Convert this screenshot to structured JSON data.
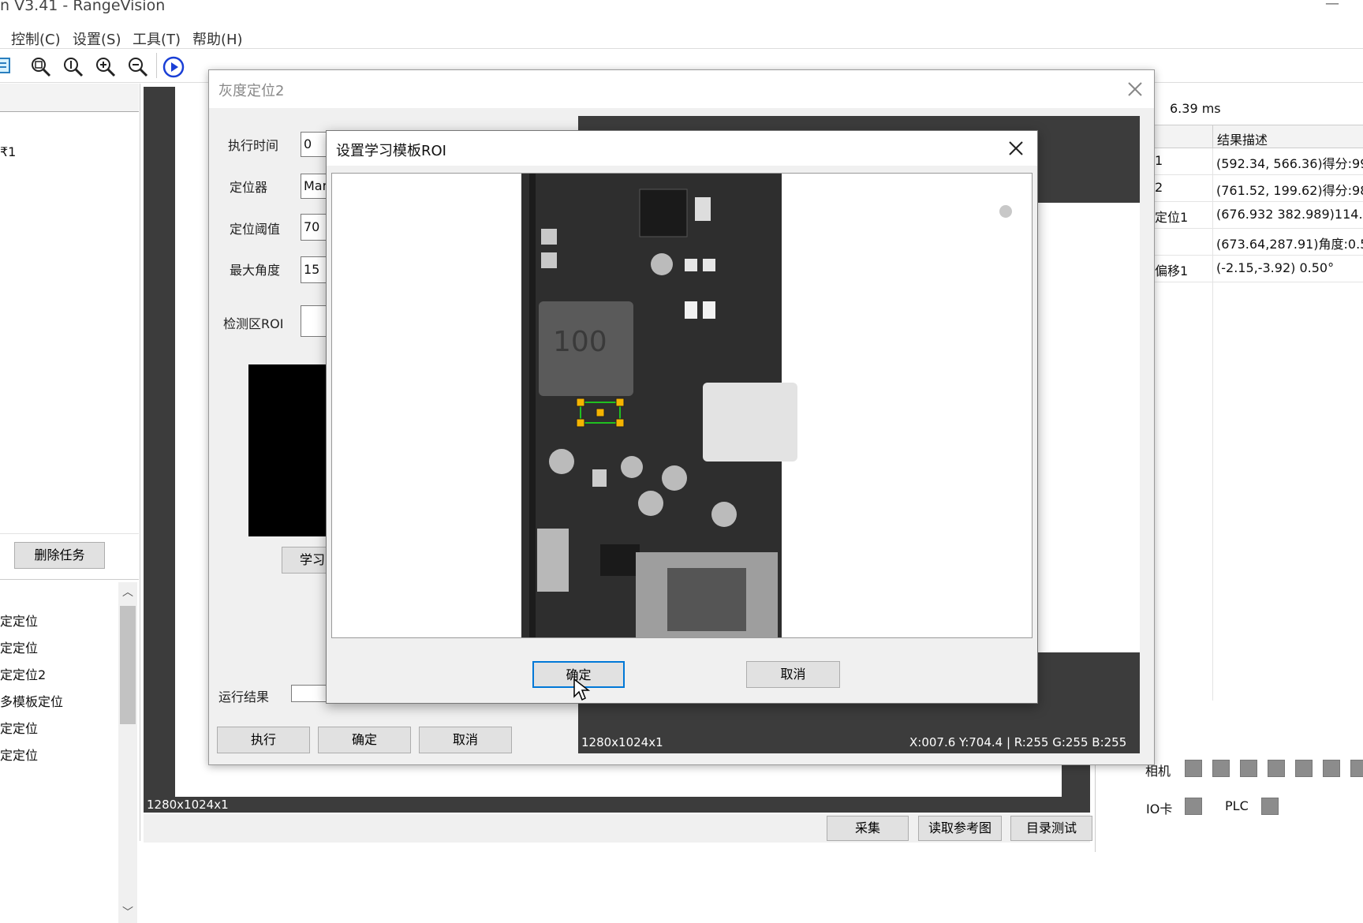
{
  "app": {
    "title": "n V3.41 - RangeVision",
    "minimize": "—"
  },
  "menu": [
    "控制(C)",
    "设置(S)",
    "工具(T)",
    "帮助(H)"
  ],
  "toolbar": {
    "icons": [
      "list-icon",
      "zoom-fit-icon",
      "zoom-actual-icon",
      "zoom-in-icon",
      "zoom-out-icon",
      "run-icon"
    ]
  },
  "left_panel": {
    "top_item": "₹1",
    "delete_task_label": "删除任务",
    "tool_list": [
      "定定位",
      "定定位",
      "定定位2",
      "多模板定位",
      "定定位",
      "定定位"
    ]
  },
  "main_canvas": {
    "image_info": "1280x1024x1"
  },
  "bottom_buttons": {
    "capture": "采集",
    "read_ref": "读取参考图",
    "dir_test": "目录测试"
  },
  "right_panel": {
    "exec_time": "6.39 ms",
    "col_header": "结果描述",
    "results": [
      {
        "name": "1",
        "desc": "(592.34, 566.36)得分:99"
      },
      {
        "name": "2",
        "desc": "(761.52, 199.62)得分:98"
      },
      {
        "name": "定位1",
        "desc": "(676.932 382.989)114.7"
      },
      {
        "name": "",
        "desc": "(673.64,287.91)角度:0.5"
      },
      {
        "name": "偏移1",
        "desc": "(-2.15,-3.92) 0.50°"
      }
    ],
    "camera_label": "相机",
    "io_label": "IO卡",
    "plc_label": "PLC"
  },
  "gray_dialog": {
    "title": "灰度定位2",
    "exec_time_label": "执行时间",
    "exec_time_value": "0",
    "locator_label": "定位器",
    "locator_value": "Mar",
    "threshold_label": "定位阈值",
    "threshold_value": "70",
    "max_angle_label": "最大角度",
    "max_angle_value": "15",
    "roi_label": "检测区ROI",
    "learn_label": "学习",
    "result_label": "运行结果",
    "exec_button": "执行",
    "ok_button": "确定",
    "cancel_button": "取消",
    "image_info": "1280x1024x1",
    "pixel_info": "X:007.6 Y:704.4 | R:255 G:255 B:255"
  },
  "roi_dialog": {
    "title": "设置学习模板ROI",
    "ok_button": "确定",
    "cancel_button": "取消"
  }
}
